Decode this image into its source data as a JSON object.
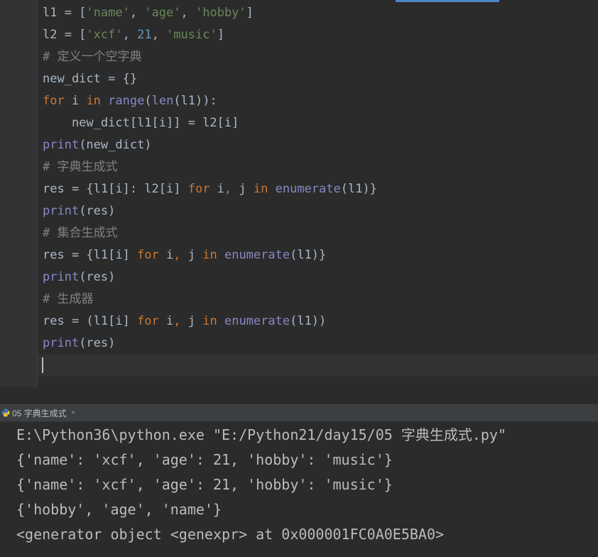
{
  "editor": {
    "lines": [
      [
        {
          "t": "l1 = [",
          "c": "id"
        },
        {
          "t": "'name'",
          "c": "str"
        },
        {
          "t": ", ",
          "c": "id"
        },
        {
          "t": "'age'",
          "c": "str"
        },
        {
          "t": ", ",
          "c": "id"
        },
        {
          "t": "'hobby'",
          "c": "str"
        },
        {
          "t": "]",
          "c": "id"
        }
      ],
      [
        {
          "t": "l2 = [",
          "c": "id"
        },
        {
          "t": "'xcf'",
          "c": "str"
        },
        {
          "t": ", ",
          "c": "id"
        },
        {
          "t": "21",
          "c": "num"
        },
        {
          "t": ", ",
          "c": "id"
        },
        {
          "t": "'music'",
          "c": "str"
        },
        {
          "t": "]",
          "c": "id"
        }
      ],
      [
        {
          "t": "# 定义一个空字典",
          "c": "cm"
        }
      ],
      [
        {
          "t": "new_dict = {}",
          "c": "id"
        }
      ],
      [
        {
          "t": "for",
          "c": "kw"
        },
        {
          "t": " i ",
          "c": "id"
        },
        {
          "t": "in",
          "c": "kw"
        },
        {
          "t": " ",
          "c": "id"
        },
        {
          "t": "range",
          "c": "bi"
        },
        {
          "t": "(",
          "c": "id"
        },
        {
          "t": "len",
          "c": "bi"
        },
        {
          "t": "(l1)):",
          "c": "id"
        }
      ],
      [
        {
          "t": "    new_dict[l1[i]] = l2[i]",
          "c": "id"
        }
      ],
      [
        {
          "t": "print",
          "c": "bi"
        },
        {
          "t": "(new_dict)",
          "c": "id"
        }
      ],
      [
        {
          "t": "# 字典生成式",
          "c": "cm"
        }
      ],
      [
        {
          "t": "res = {l1[i]: l2[i] ",
          "c": "id"
        },
        {
          "t": "for",
          "c": "kw"
        },
        {
          "t": " i",
          "c": "id"
        },
        {
          "t": ",",
          "c": "kw"
        },
        {
          "t": " j ",
          "c": "id"
        },
        {
          "t": "in",
          "c": "kw"
        },
        {
          "t": " ",
          "c": "id"
        },
        {
          "t": "enumerate",
          "c": "bi"
        },
        {
          "t": "(l1)}",
          "c": "id"
        }
      ],
      [
        {
          "t": "print",
          "c": "bi"
        },
        {
          "t": "(res)",
          "c": "id"
        }
      ],
      [
        {
          "t": "# 集合生成式",
          "c": "cm"
        }
      ],
      [
        {
          "t": "res = {l1[i] ",
          "c": "id"
        },
        {
          "t": "for",
          "c": "kw"
        },
        {
          "t": " i",
          "c": "id"
        },
        {
          "t": ",",
          "c": "kw"
        },
        {
          "t": " j ",
          "c": "id"
        },
        {
          "t": "in",
          "c": "kw"
        },
        {
          "t": " ",
          "c": "id"
        },
        {
          "t": "enumerate",
          "c": "bi"
        },
        {
          "t": "(l1)}",
          "c": "id"
        }
      ],
      [
        {
          "t": "print",
          "c": "bi"
        },
        {
          "t": "(res)",
          "c": "id"
        }
      ],
      [
        {
          "t": "# 生成器",
          "c": "cm"
        }
      ],
      [
        {
          "t": "res = (l1[i] ",
          "c": "id"
        },
        {
          "t": "for",
          "c": "kw"
        },
        {
          "t": " i",
          "c": "id"
        },
        {
          "t": ",",
          "c": "kw"
        },
        {
          "t": " j ",
          "c": "id"
        },
        {
          "t": "in",
          "c": "kw"
        },
        {
          "t": " ",
          "c": "id"
        },
        {
          "t": "enumerate",
          "c": "bi"
        },
        {
          "t": "(l1))",
          "c": "id"
        }
      ],
      [
        {
          "t": "print",
          "c": "bi"
        },
        {
          "t": "(res)",
          "c": "id"
        }
      ]
    ]
  },
  "run_panel": {
    "tab_label": "05 字典生成式",
    "tab_close": "×",
    "tab_icon": "python-icon"
  },
  "console": {
    "lines": [
      "E:\\Python36\\python.exe \"E:/Python21/day15/05 字典生成式.py\"",
      "{'name': 'xcf', 'age': 21, 'hobby': 'music'}",
      "{'name': 'xcf', 'age': 21, 'hobby': 'music'}",
      "{'hobby', 'age', 'name'}",
      "<generator object <genexpr> at 0x000001FC0A0E5BA0>"
    ]
  },
  "colors": {
    "background": "#2b2b2b",
    "keyword": "#cc7832",
    "string": "#6a8759",
    "number": "#6897bb",
    "comment": "#808080",
    "builtin": "#8888c6",
    "identifier": "#a9b7c6",
    "console_text": "#bbbbbb"
  }
}
